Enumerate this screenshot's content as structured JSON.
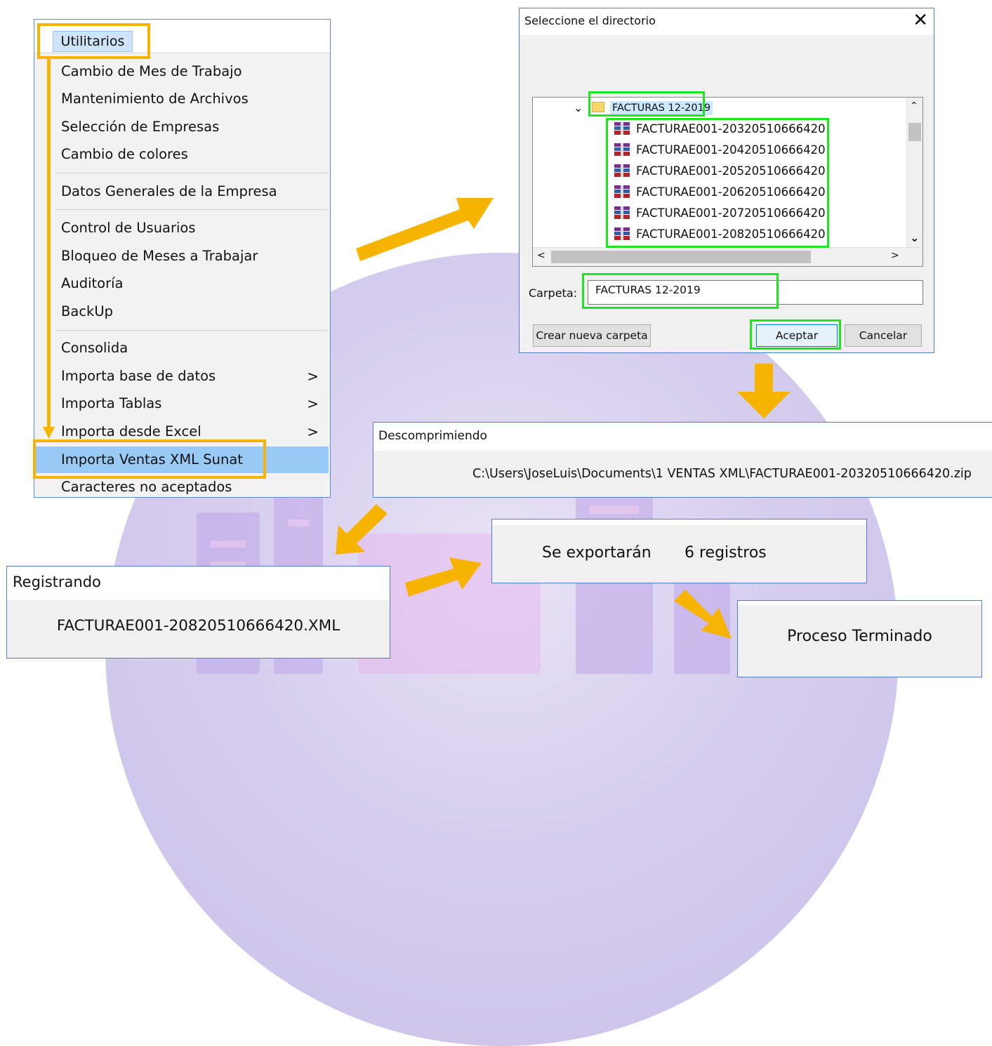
{
  "menu": {
    "tab_label": "Utilitarios",
    "tab_cut_label": ":",
    "items": [
      {
        "label": "Cambio de Mes de Trabajo"
      },
      {
        "label": "Mantenimiento de Archivos"
      },
      {
        "label": "Selección de Empresas"
      },
      {
        "label": "Cambio de colores"
      },
      {
        "label": "Datos Generales de la Empresa"
      },
      {
        "label": "Control de Usuarios"
      },
      {
        "label": "Bloqueo de Meses a Trabajar"
      },
      {
        "label": "Auditoría"
      },
      {
        "label": "BackUp"
      },
      {
        "label": "Consolida"
      },
      {
        "label": "Importa base de datos",
        "submenu_arrow": ">"
      },
      {
        "label": "Importa Tablas",
        "submenu_arrow": ">"
      },
      {
        "label": "Importa desde Excel",
        "submenu_arrow": ">"
      },
      {
        "label": "Importa Ventas XML Sunat"
      },
      {
        "label": "Caracteres no aceptados"
      }
    ]
  },
  "directory_dialog": {
    "title": "Seleccione el directorio",
    "close_glyph": "✕",
    "folder": "FACTURAS 12-2019",
    "files": [
      "FACTURAE001-20320510666420",
      "FACTURAE001-20420510666420",
      "FACTURAE001-20520510666420",
      "FACTURAE001-20620510666420",
      "FACTURAE001-20720510666420",
      "FACTURAE001-20820510666420"
    ],
    "expand_glyph": "⌄",
    "scroll_up": "⌃",
    "scroll_down": "⌄",
    "scroll_left": "<",
    "scroll_right": ">",
    "folder_label": "Carpeta:",
    "folder_value": "FACTURAS 12-2019",
    "new_folder_button": "Crear nueva carpeta",
    "accept_button": "Aceptar",
    "cancel_button": "Cancelar"
  },
  "decompress_window": {
    "title": "Descomprimiendo",
    "path": "C:\\Users\\JoseLuis\\Documents\\1 VENTAS XML\\FACTURAE001-20320510666420.zip"
  },
  "register_window": {
    "title": "Registrando",
    "file": "FACTURAE001-20820510666420.XML"
  },
  "export_window": {
    "label": "Se exportarán",
    "count": "6 registros"
  },
  "done_window": {
    "message": "Proceso Terminado"
  },
  "colors": {
    "highlight_orange": "#f6b300",
    "highlight_green": "#1ee61e",
    "menu_selection": "#99c9f5",
    "window_border": "#4d7ec7"
  }
}
